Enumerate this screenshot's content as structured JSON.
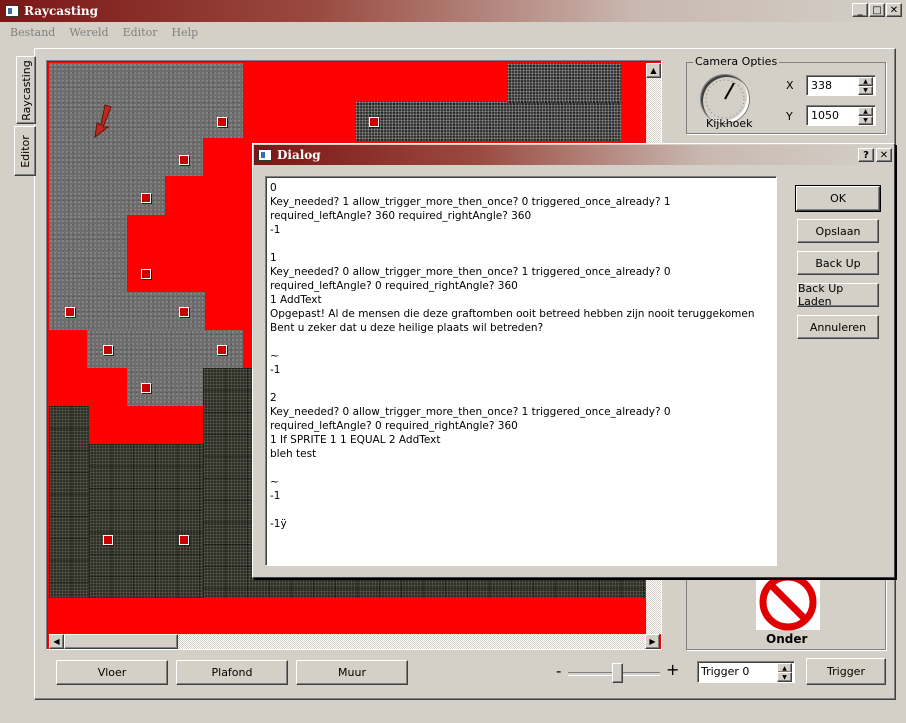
{
  "window": {
    "title": "Raycasting"
  },
  "menu": {
    "items": [
      "Bestand",
      "Wereld",
      "Editor",
      "Help"
    ]
  },
  "tabs": {
    "raycasting": "Raycasting",
    "editor": "Editor"
  },
  "camera": {
    "group_title": "Camera Opties",
    "dial_label": "Kijkhoek",
    "x_label": "X",
    "x_value": "338",
    "y_label": "Y",
    "y_value": "1050"
  },
  "bottom": {
    "vloer": "Vloer",
    "plafond": "Plafond",
    "muur": "Muur",
    "zoom_minus": "-",
    "zoom_plus": "+",
    "trigger_spin_value": "Trigger 0",
    "trigger_button": "Trigger"
  },
  "onder_label": "Onder",
  "dialog": {
    "title": "Dialog",
    "help": "?",
    "close": "✕",
    "buttons": {
      "ok": "OK",
      "save": "Opslaan",
      "backup": "Back Up",
      "load_backup": "Back Up Laden",
      "cancel": "Annuleren"
    },
    "text_lines": [
      "0",
      "Key_needed? 1 allow_trigger_more_then_once? 0 triggered_once_already? 1",
      "required_leftAngle? 360 required_rightAngle? 360",
      "-1",
      "",
      "1",
      "Key_needed? 0 allow_trigger_more_then_once? 1 triggered_once_already? 0",
      "required_leftAngle? 0 required_rightAngle? 360",
      "1 AddText",
      "Opgepast! Al de mensen die deze graftomben ooit betreed hebben zijn nooit teruggekomen",
      "Bent u zeker dat u deze heilige plaats wil betreden?",
      "",
      "~",
      "-1",
      "",
      "2",
      "Key_needed? 0 allow_trigger_more_then_once? 1 triggered_once_already? 0",
      "required_leftAngle? 0 required_rightAngle? 360",
      "1 If SPRITE 1 1 EQUAL 2 AddText",
      "bleh test",
      "",
      "~",
      "-1",
      "",
      "-1ÿ"
    ]
  },
  "colors": {
    "title_dark": "#7a1616",
    "title_light": "#d4d0c8",
    "wall": "#ff0000",
    "face": "#d4d0c8"
  },
  "icons": [
    "minimize-icon",
    "maximize-icon",
    "close-icon",
    "arrow-marker-icon",
    "no-entry-icon",
    "help-icon"
  ]
}
